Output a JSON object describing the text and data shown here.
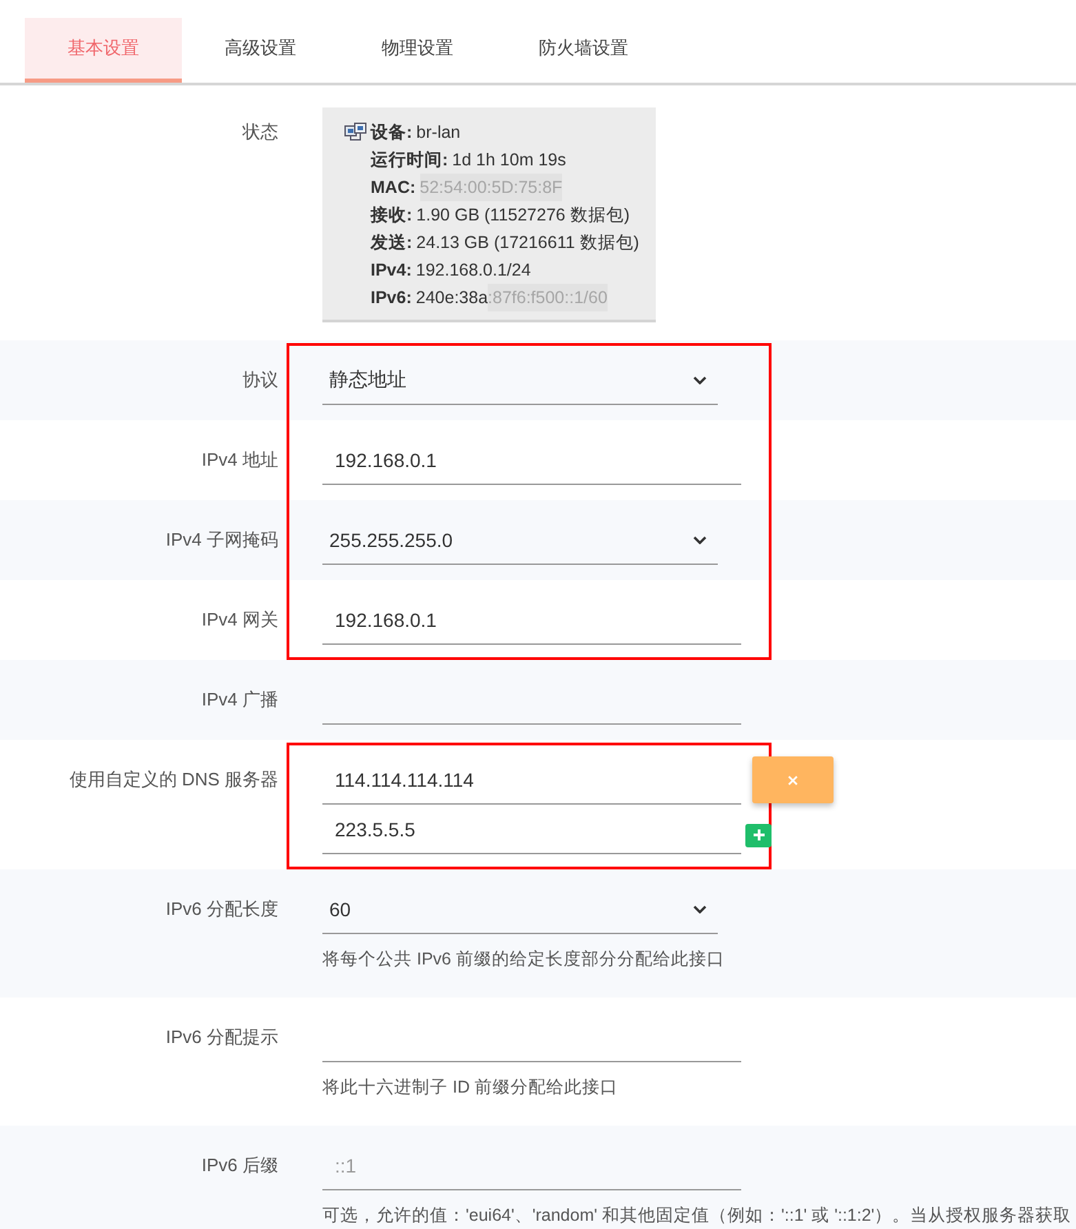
{
  "tabs": [
    {
      "label": "基本设置",
      "selected": true
    },
    {
      "label": "高级设置",
      "selected": false
    },
    {
      "label": "物理设置",
      "selected": false
    },
    {
      "label": "防火墙设置",
      "selected": false
    }
  ],
  "groups": [
    {
      "highlighted": false,
      "rows": [
        {
          "kind": "status",
          "label": "状态",
          "lines": [
            {
              "label": "设备:",
              "value": "br-lan"
            },
            {
              "label": "运行时间:",
              "value": "1d 1h 10m 19s"
            },
            {
              "label": "MAC:",
              "masked": "52:54:00:5D:75:8F"
            },
            {
              "label": "接收:",
              "value": "1.90 GB (11527276 数据包)"
            },
            {
              "label": "发送:",
              "value": "24.13 GB (17216611 数据包)"
            },
            {
              "label": "IPv4:",
              "value": "192.168.0.1/24"
            },
            {
              "label": "IPv6:",
              "value": "240e:38a",
              "masked": ":87f6:f500::1/60"
            }
          ]
        }
      ]
    },
    {
      "highlighted": true,
      "rows": [
        {
          "kind": "select",
          "label": "协议",
          "value": "静态地址"
        },
        {
          "kind": "input",
          "label": "IPv4 地址",
          "value": "192.168.0.1"
        },
        {
          "kind": "select",
          "label": "IPv4 子网掩码",
          "value": "255.255.255.0"
        },
        {
          "kind": "input",
          "label": "IPv4 网关",
          "value": "192.168.0.1"
        }
      ]
    },
    {
      "highlighted": false,
      "rows": [
        {
          "kind": "input",
          "label": "IPv4 广播"
        }
      ]
    },
    {
      "highlighted": true,
      "rows": [
        {
          "kind": "dynlist",
          "label": "使用自定义的 DNS 服务器",
          "entries": [
            {
              "value": "114.114.114.114",
              "kind": "remove"
            },
            {
              "value": "223.5.5.5",
              "kind": "add"
            }
          ]
        }
      ]
    },
    {
      "highlighted": false,
      "rows": [
        {
          "kind": "select",
          "label": "IPv6 分配长度",
          "value": "60",
          "description": "将每个公共 IPv6 前缀的给定长度部分分配给此接口"
        },
        {
          "kind": "input",
          "label": "IPv6 分配提示",
          "description": "将此十六进制子 ID 前缀分配给此接口"
        },
        {
          "kind": "input",
          "label": "IPv6 后缀",
          "placeholder": "::1",
          "description": "可选，允许的值：'eui64'、'random' 和其他固定值（例如：'::1' 或 '::1:2'）。当从授权服务器获取"
        }
      ]
    }
  ]
}
